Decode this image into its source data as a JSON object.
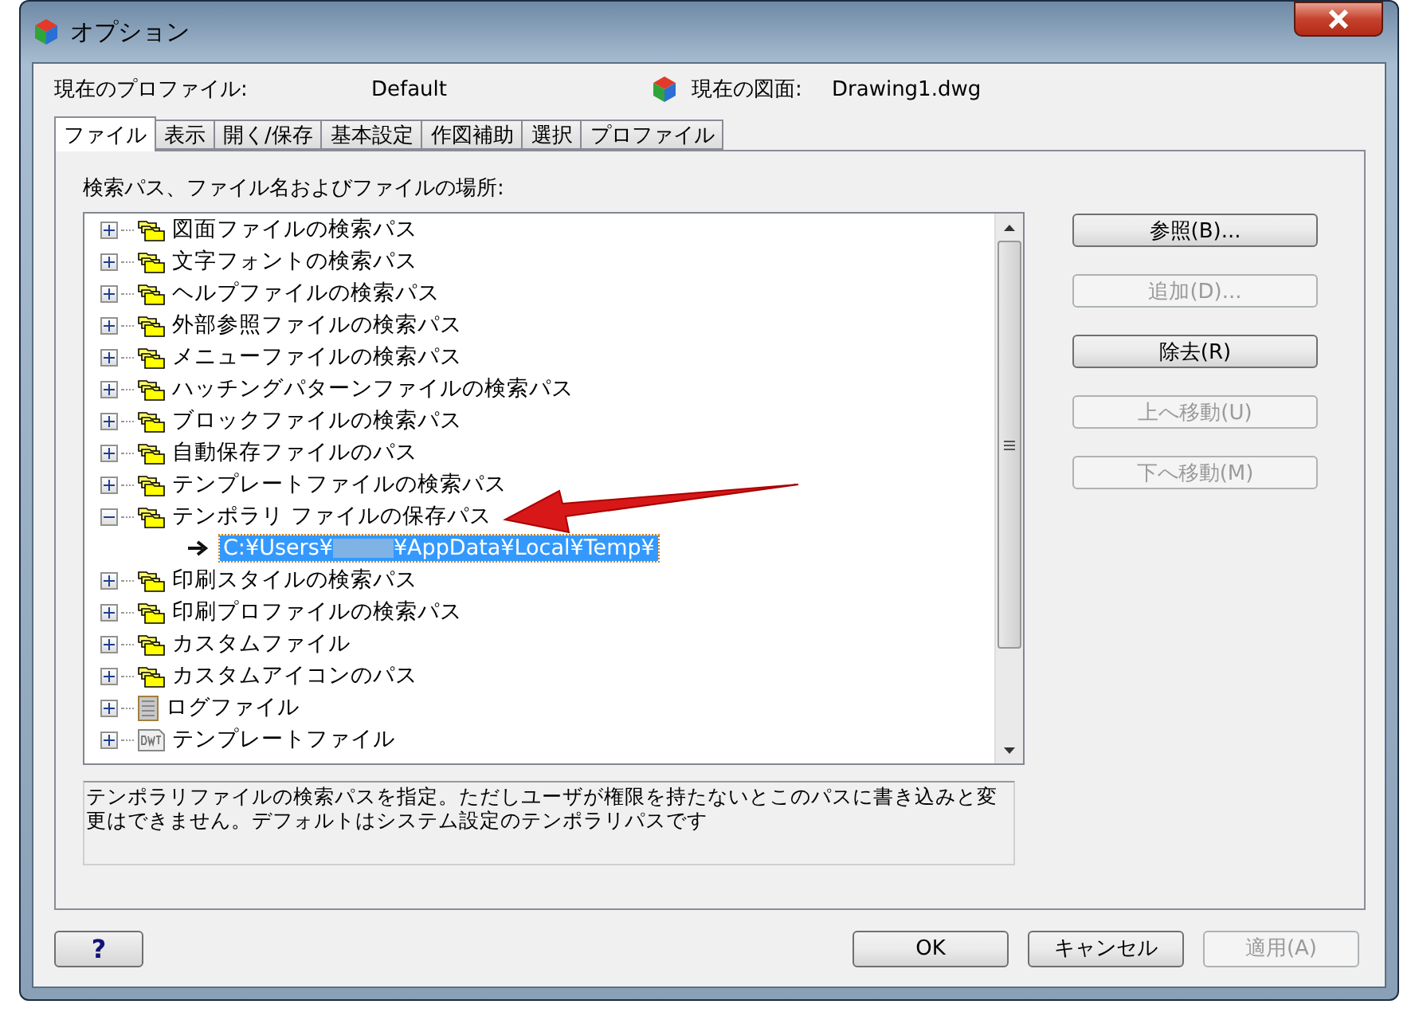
{
  "window": {
    "title": "オプション"
  },
  "profile": {
    "label": "現在のプロファイル:",
    "value": "Default",
    "drawing_label": "現在の図面:",
    "drawing_value": "Drawing1.dwg"
  },
  "tabs": [
    {
      "label": "ファイル",
      "selected": true
    },
    {
      "label": "表示",
      "selected": false
    },
    {
      "label": "開く/保存",
      "selected": false
    },
    {
      "label": "基本設定",
      "selected": false
    },
    {
      "label": "作図補助",
      "selected": false
    },
    {
      "label": "選択",
      "selected": false
    },
    {
      "label": "プロファイル",
      "selected": false
    }
  ],
  "tree": {
    "label": "検索パス、ファイル名およびファイルの場所:",
    "items": [
      {
        "label": "図面ファイルの検索パス",
        "kind": "folder",
        "expanded": false
      },
      {
        "label": "文字フォントの検索パス",
        "kind": "folder",
        "expanded": false
      },
      {
        "label": "ヘルプファイルの検索パス",
        "kind": "folder",
        "expanded": false
      },
      {
        "label": "外部参照ファイルの検索パス",
        "kind": "folder",
        "expanded": false
      },
      {
        "label": "メニューファイルの検索パス",
        "kind": "folder",
        "expanded": false
      },
      {
        "label": "ハッチングパターンファイルの検索パス",
        "kind": "folder",
        "expanded": false
      },
      {
        "label": "ブロックファイルの検索パス",
        "kind": "folder",
        "expanded": false
      },
      {
        "label": "自動保存ファイルのパス",
        "kind": "folder",
        "expanded": false
      },
      {
        "label": "テンプレートファイルの検索パス",
        "kind": "folder",
        "expanded": false
      },
      {
        "label": "テンポラリ ファイルの保存パス",
        "kind": "folder",
        "expanded": true,
        "children": [
          {
            "text_before": "C:¥Users¥",
            "text_after": "¥AppData¥Local¥Temp¥",
            "redacted": true,
            "selected": true
          }
        ]
      },
      {
        "label": "印刷スタイルの検索パス",
        "kind": "folder",
        "expanded": false
      },
      {
        "label": "印刷プロファイルの検索パス",
        "kind": "folder",
        "expanded": false
      },
      {
        "label": "カスタムファイル",
        "kind": "folder",
        "expanded": false
      },
      {
        "label": "カスタムアイコンのパス",
        "kind": "folder",
        "expanded": false
      },
      {
        "label": "ログファイル",
        "kind": "log",
        "expanded": false
      },
      {
        "label": "テンプレートファイル",
        "kind": "template",
        "expanded": false
      }
    ]
  },
  "side_buttons": [
    {
      "label": "参照(B)...",
      "disabled": false
    },
    {
      "label": "追加(D)...",
      "disabled": true
    },
    {
      "label": "除去(R)",
      "disabled": false
    },
    {
      "label": "上へ移動(U)",
      "disabled": true
    },
    {
      "label": "下へ移動(M)",
      "disabled": true
    }
  ],
  "description": "テンポラリファイルの検索パスを指定。ただしユーザが権限を持たないとこのパスに書き込みと変更はできません。デフォルトはシステム設定のテンポラリパスです",
  "footer": {
    "help": "?",
    "buttons": [
      {
        "label": "OK",
        "disabled": false
      },
      {
        "label": "キャンセル",
        "disabled": false
      },
      {
        "label": "適用(A)",
        "disabled": true
      }
    ]
  }
}
